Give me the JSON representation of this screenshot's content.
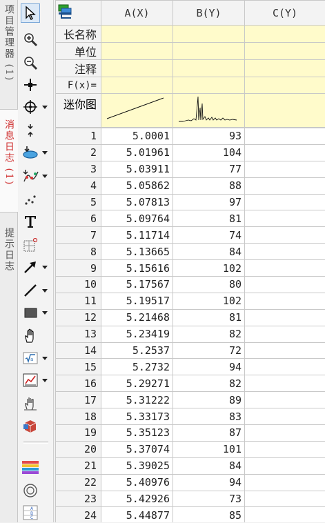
{
  "left_tabs": [
    {
      "label": "项目管理器 (1)",
      "active": false
    },
    {
      "label": "消息日志 (1)",
      "active": true
    },
    {
      "label": "提示日志",
      "active": false
    }
  ],
  "toolbar": {
    "tools": [
      {
        "icon": "pointer-icon",
        "dropdown": false,
        "selected": true
      },
      {
        "icon": "zoom-in-icon",
        "dropdown": false
      },
      {
        "icon": "zoom-out-icon",
        "dropdown": false
      },
      {
        "icon": "data-reader-icon",
        "dropdown": false
      },
      {
        "icon": "screen-reader-icon",
        "dropdown": true
      },
      {
        "icon": "data-selector-icon",
        "dropdown": false
      },
      {
        "icon": "region-select-icon",
        "dropdown": true
      },
      {
        "icon": "mask-points-icon",
        "dropdown": true
      },
      {
        "icon": "draw-data-icon",
        "dropdown": false
      },
      {
        "icon": "text-tool-icon",
        "dropdown": false
      },
      {
        "icon": "annotation-icon",
        "dropdown": false
      },
      {
        "icon": "arrow-tool-icon",
        "dropdown": true
      },
      {
        "icon": "line-tool-icon",
        "dropdown": true
      },
      {
        "icon": "rectangle-tool-icon",
        "dropdown": true
      },
      {
        "icon": "hand-pan-icon",
        "dropdown": false
      },
      {
        "icon": "equation-tool-icon",
        "dropdown": true
      },
      {
        "icon": "insert-graph-icon",
        "dropdown": true
      },
      {
        "icon": "spider-tool-icon",
        "dropdown": false
      },
      {
        "icon": "3d-box-icon",
        "dropdown": false
      },
      {
        "icon": "color-bars-icon",
        "dropdown": false
      },
      {
        "icon": "circle-tool-icon",
        "dropdown": false
      },
      {
        "icon": "abc-list-icon",
        "dropdown": false
      }
    ]
  },
  "sheet": {
    "columns": [
      "A(X)",
      "B(Y)",
      "C(Y)"
    ],
    "meta_labels": [
      "长名称",
      "单位",
      "注释",
      "F(x)=",
      "迷你图"
    ],
    "rows": [
      {
        "n": "1",
        "a": "5.0001",
        "b": "93"
      },
      {
        "n": "2",
        "a": "5.01961",
        "b": "104"
      },
      {
        "n": "3",
        "a": "5.03911",
        "b": "77"
      },
      {
        "n": "4",
        "a": "5.05862",
        "b": "88"
      },
      {
        "n": "5",
        "a": "5.07813",
        "b": "97"
      },
      {
        "n": "6",
        "a": "5.09764",
        "b": "81"
      },
      {
        "n": "7",
        "a": "5.11714",
        "b": "74"
      },
      {
        "n": "8",
        "a": "5.13665",
        "b": "84"
      },
      {
        "n": "9",
        "a": "5.15616",
        "b": "102"
      },
      {
        "n": "10",
        "a": "5.17567",
        "b": "80"
      },
      {
        "n": "11",
        "a": "5.19517",
        "b": "102"
      },
      {
        "n": "12",
        "a": "5.21468",
        "b": "81"
      },
      {
        "n": "13",
        "a": "5.23419",
        "b": "82"
      },
      {
        "n": "14",
        "a": "5.2537",
        "b": "72"
      },
      {
        "n": "15",
        "a": "5.2732",
        "b": "94"
      },
      {
        "n": "16",
        "a": "5.29271",
        "b": "82"
      },
      {
        "n": "17",
        "a": "5.31222",
        "b": "89"
      },
      {
        "n": "18",
        "a": "5.33173",
        "b": "83"
      },
      {
        "n": "19",
        "a": "5.35123",
        "b": "87"
      },
      {
        "n": "20",
        "a": "5.37074",
        "b": "101"
      },
      {
        "n": "21",
        "a": "5.39025",
        "b": "84"
      },
      {
        "n": "22",
        "a": "5.40976",
        "b": "94"
      },
      {
        "n": "23",
        "a": "5.42926",
        "b": "73"
      },
      {
        "n": "24",
        "a": "5.44877",
        "b": "85"
      }
    ]
  },
  "colors": {
    "meta_bg": "#fffbcb",
    "active_tab_text": "#d03030",
    "header_bg": "#f3f3f3"
  }
}
